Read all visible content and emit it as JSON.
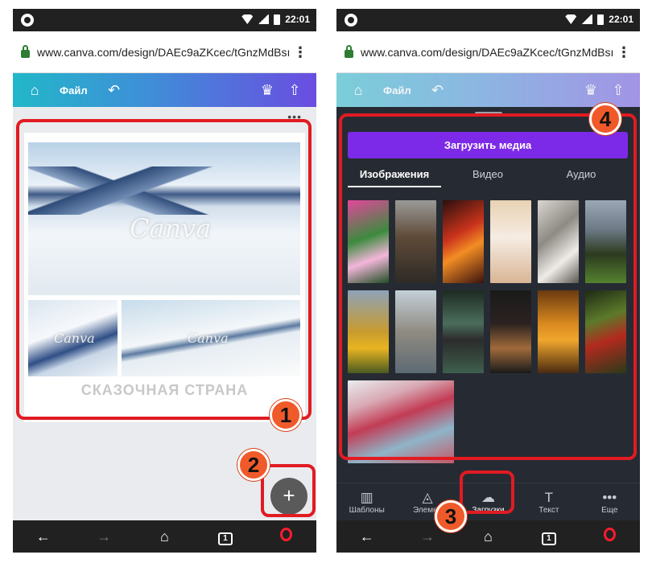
{
  "status": {
    "time": "22:01"
  },
  "browser": {
    "url": "www.canva.com/design/DAEc9aZKcec/tGnzMdBsı"
  },
  "editor": {
    "file_label": "Файл"
  },
  "design": {
    "title": "СКАЗОЧНАЯ СТРАНА",
    "watermark": "Canva"
  },
  "upload": {
    "button_label": "Загрузить медиа"
  },
  "media_tabs": [
    {
      "label": "Изображения",
      "active": true
    },
    {
      "label": "Видео",
      "active": false
    },
    {
      "label": "Аудио",
      "active": false
    }
  ],
  "bottom_tabs": [
    {
      "label": "Шаблоны",
      "icon": "layout-icon"
    },
    {
      "label": "Элемен",
      "icon": "shapes-icon"
    },
    {
      "label": "Загрузки",
      "icon": "cloud-upload-icon",
      "active": true
    },
    {
      "label": "Текст",
      "icon": "text-icon"
    },
    {
      "label": "Еще",
      "icon": "more-icon"
    }
  ],
  "badges": {
    "b1": "1",
    "b2": "2",
    "b3": "3",
    "b4": "4"
  },
  "icons": {
    "fab": "+",
    "tabs_count": "1"
  },
  "colors": {
    "accent": "#7d2ae8",
    "annotation": "#e11b22",
    "badge": "#f05a2a"
  }
}
